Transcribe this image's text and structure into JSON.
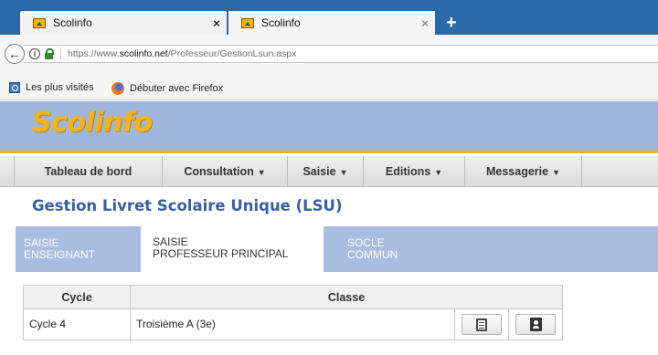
{
  "browser": {
    "tabs": [
      {
        "title": "Scolinfo",
        "close": "×"
      },
      {
        "title": "Scolinfo",
        "close": "×"
      }
    ],
    "new_tab": "+",
    "url_prefix": "https://www.",
    "url_domain": "scolinfo.net",
    "url_path": "/Professeur/GestionLsun.aspx",
    "bookmarks": [
      {
        "label": "Les plus visités",
        "icon": "folder-icon"
      },
      {
        "label": "Débuter avec Firefox",
        "icon": "firefox-icon"
      }
    ]
  },
  "site": {
    "logo": "Scolinfo",
    "menu": [
      {
        "label": "Tableau de bord",
        "caret": ""
      },
      {
        "label": "Consultation",
        "caret": "▼"
      },
      {
        "label": "Saisie",
        "caret": "▼"
      },
      {
        "label": "Editions",
        "caret": "▼"
      },
      {
        "label": "Messagerie",
        "caret": "▼"
      }
    ],
    "page_title": "Gestion Livret Scolaire Unique (LSU)",
    "subtabs": [
      {
        "line1": "SAISIE",
        "line2": "ENSEIGNANT"
      },
      {
        "line1": "SAISIE",
        "line2": "PROFESSEUR PRINCIPAL"
      },
      {
        "line1": "SOCLE",
        "line2": "COMMUN"
      }
    ],
    "table": {
      "headers": [
        "Cycle",
        "Classe"
      ],
      "rows": [
        {
          "cycle": "Cycle 4",
          "classe": "Troisième A (3e)"
        }
      ]
    }
  },
  "colors": {
    "tab_strip": "#2a6aa8",
    "header_blue": "#9fb6dc",
    "accent_gold": "#f0b21a",
    "title_blue": "#3a5fa0"
  }
}
